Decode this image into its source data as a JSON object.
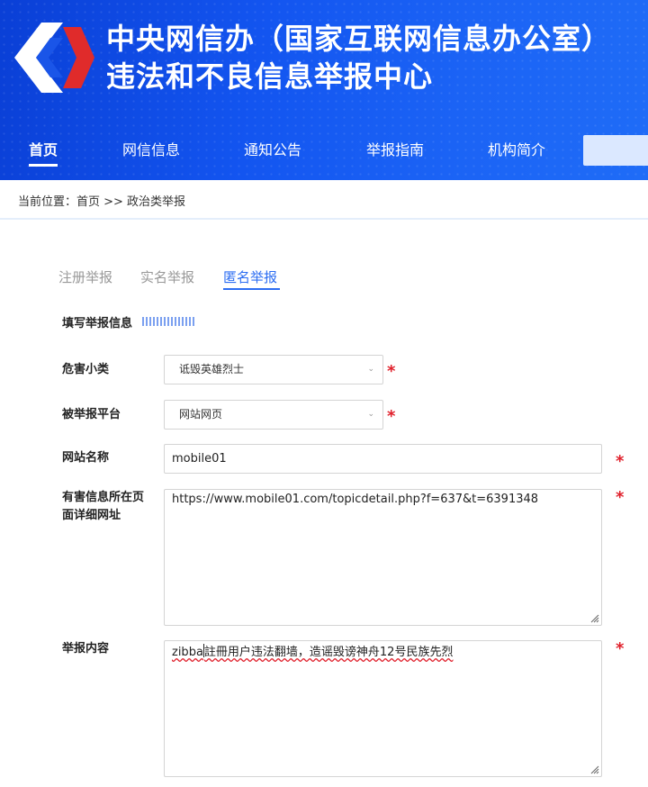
{
  "header": {
    "title_line1": "中央网信办（国家互联网信息办公室）",
    "title_line2": "违法和不良信息举报中心",
    "logo_icon": "report-center-logo-icon"
  },
  "nav": {
    "items": [
      {
        "label": "首页",
        "active": true
      },
      {
        "label": "网信信息"
      },
      {
        "label": "通知公告"
      },
      {
        "label": "举报指南"
      },
      {
        "label": "机构简介"
      }
    ]
  },
  "breadcrumb": {
    "text": "当前位置：首页 >> 政治类举报"
  },
  "tabs": [
    {
      "label": "注册举报"
    },
    {
      "label": "实名举报"
    },
    {
      "label": "匿名举报",
      "active": true
    }
  ],
  "form": {
    "section_title": "填写举报信息",
    "fields": {
      "subcategory": {
        "label": "危害小类",
        "value": "诋毁英雄烈士"
      },
      "platform": {
        "label": "被举报平台",
        "value": "网站网页"
      },
      "site_name": {
        "label": "网站名称",
        "value": "mobile01"
      },
      "page_url": {
        "label": "有害信息所在页面详细网址",
        "value": "https://www.mobile01.com/topicdetail.php?f=637&t=6391348"
      },
      "content": {
        "label": "举报内容",
        "value_prefix": "zibba",
        "value_rest": "註冊用户违法翻墙，造谣毁谤神舟12号民族先烈"
      }
    },
    "required_mark": "*"
  },
  "colors": {
    "brand_blue": "#1355f0",
    "accent": "#2c6df2",
    "required": "#e0212c"
  }
}
